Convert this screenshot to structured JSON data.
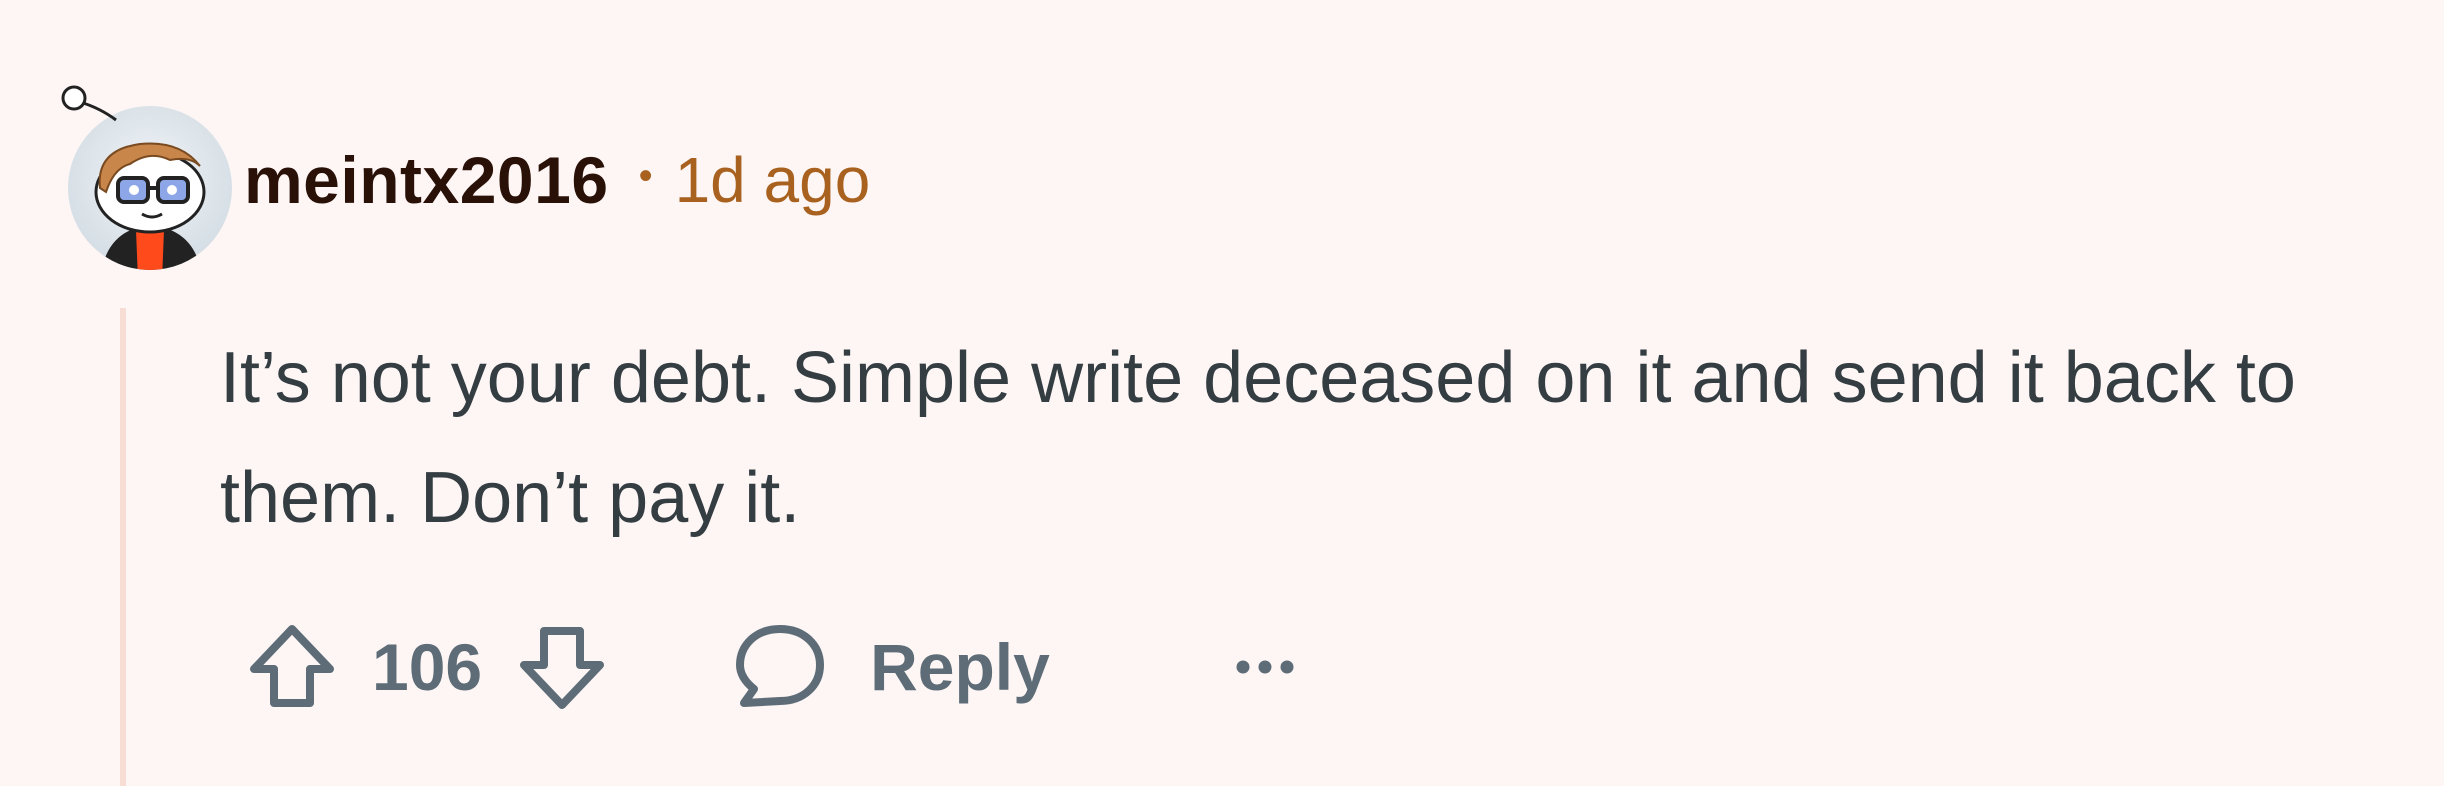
{
  "comment": {
    "author": "meintx2016",
    "separator": "•",
    "timestamp": "1d ago",
    "body": "It’s not your debt. Simple write deceased on it and send it back to them. Don’t pay it.",
    "score": "106",
    "reply_label": "Reply"
  },
  "icons": {
    "upvote": "upvote-arrow-icon",
    "downvote": "downvote-arrow-icon",
    "reply": "speech-bubble-icon",
    "more": "ellipsis-icon"
  },
  "colors": {
    "background": "#fdf6f5",
    "username": "#2a1108",
    "timestamp": "#a8611f",
    "body_text": "#333d42",
    "action_text": "#5d6c77",
    "thread_line": "#f7ddd3"
  }
}
